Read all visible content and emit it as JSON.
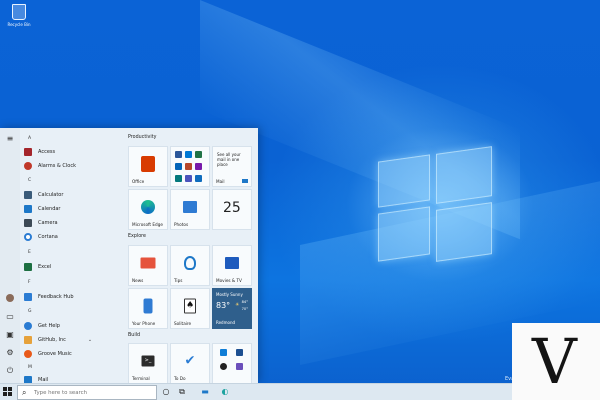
{
  "desktop": {
    "recycle_bin_label": "Recycle Bin",
    "watermark": "Evaluation copy"
  },
  "start_menu": {
    "letters": [
      "A",
      "C",
      "E",
      "F",
      "G",
      "M"
    ],
    "apps": [
      {
        "label": "Access",
        "color": "#a4262c"
      },
      {
        "label": "Alarms & Clock",
        "color": "#c0392b"
      },
      {
        "label": "Calculator",
        "color": "#3a5b7a"
      },
      {
        "label": "Calendar",
        "color": "#1e78c8"
      },
      {
        "label": "Camera",
        "color": "#3d4a57"
      },
      {
        "label": "Cortana",
        "color": "#2b7cd3"
      },
      {
        "label": "Excel",
        "color": "#1d6f42"
      },
      {
        "label": "Feedback Hub",
        "color": "#2b7cd3"
      },
      {
        "label": "Get Help",
        "color": "#2b7cd3"
      },
      {
        "label": "GitHub, Inc",
        "color": "#e6a23c"
      },
      {
        "label": "Groove Music",
        "color": "#e85a1a"
      },
      {
        "label": "Mail",
        "color": "#1e78c8"
      }
    ],
    "groups": {
      "productivity": "Productivity",
      "explore": "Explore",
      "build": "Build"
    },
    "tiles": {
      "office": "Office",
      "mail": "Mail",
      "mail_text": "See all your mail in one place",
      "edge": "Microsoft Edge",
      "photos": "Photos",
      "calendar_day": "25",
      "news": "News",
      "tips": "Tips",
      "movies": "Movies & TV",
      "your_phone": "Your Phone",
      "solitaire": "Solitaire",
      "weather_condition": "Mostly Sunny",
      "weather_temp": "83°",
      "weather_hi": "84°",
      "weather_lo": "70°",
      "weather_city": "Redmond",
      "terminal": "Terminal",
      "todo": "To Do"
    }
  },
  "taskbar": {
    "search_placeholder": "Type here to search"
  },
  "colors": {
    "desktop_blue": "#0b63d6",
    "start_bg": "#e8f0f7",
    "weather_tile": "#2f5f8c",
    "taskbar": "#dde8f1"
  }
}
